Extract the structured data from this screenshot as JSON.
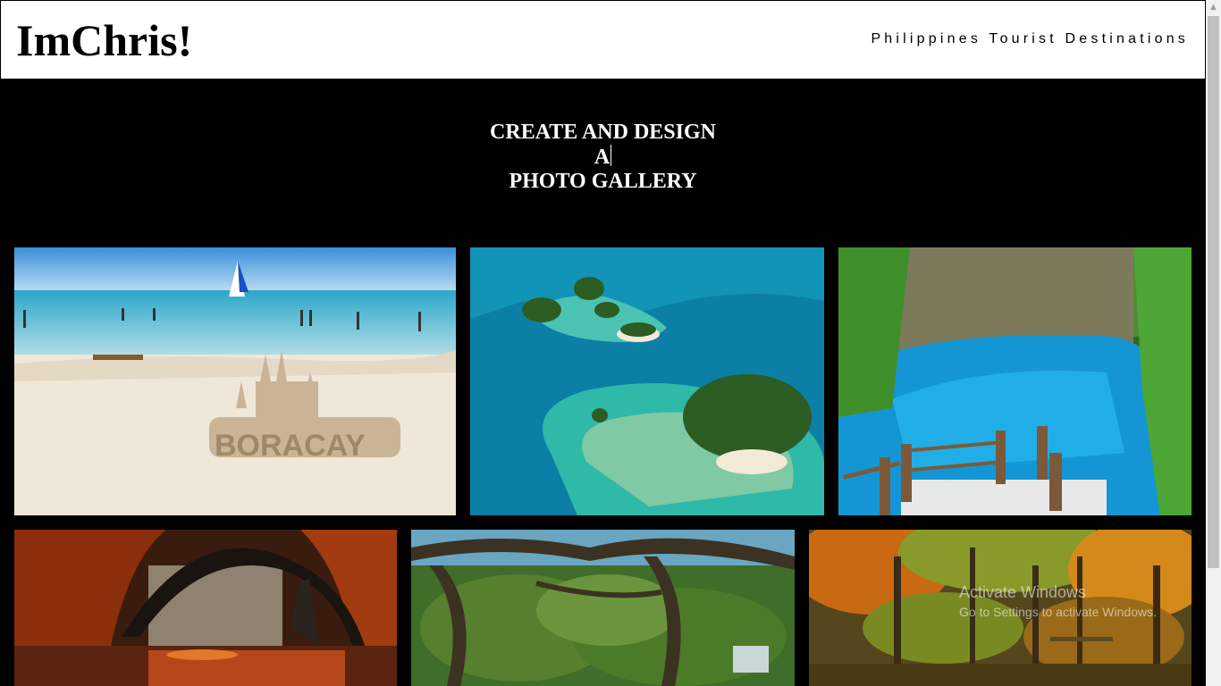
{
  "header": {
    "logo": "ImChris!",
    "nav_link": "Philippines Tourist Destinations"
  },
  "hero": {
    "line1": "CREATE AND DESIGN",
    "line2": "A",
    "line3": "PHOTO GALLERY"
  },
  "gallery": {
    "photos": [
      "boracay-beach-photo",
      "island-lagoon-photo",
      "blue-river-photo",
      "stone-bridge-autumn-photo",
      "tree-canopy-photo",
      "autumn-forest-photo"
    ]
  },
  "watermark": {
    "line1": "Activate Windows",
    "line2": "Go to Settings to activate Windows."
  },
  "colors": {
    "background": "#000000",
    "header_bg": "#ffffff",
    "text_light": "#ffffff"
  }
}
